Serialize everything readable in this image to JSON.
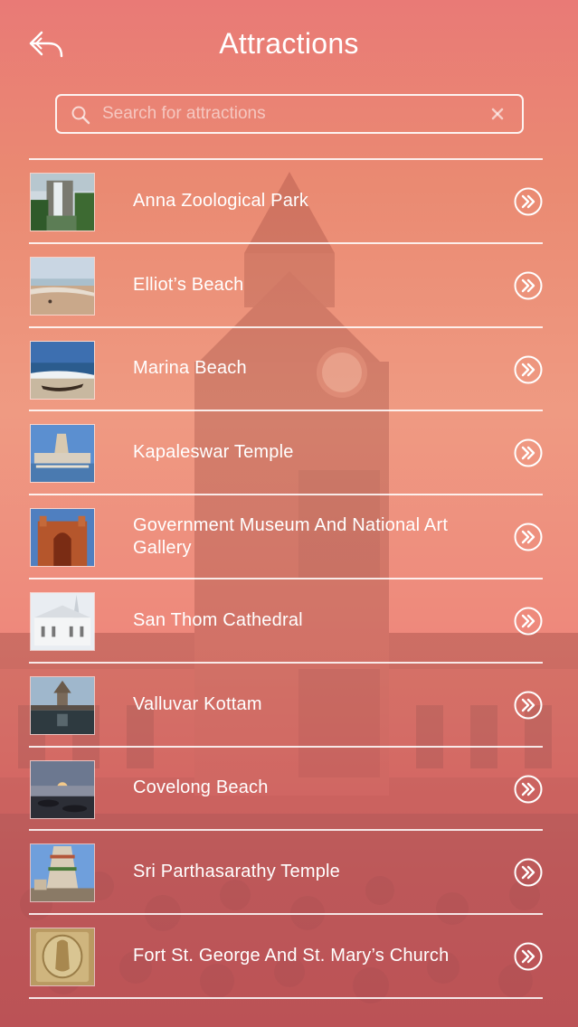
{
  "header": {
    "title": "Attractions",
    "back_icon": "back-arrow-icon"
  },
  "search": {
    "placeholder": "Search for attractions",
    "value": "",
    "icon": "search-icon",
    "clear_icon": "clear-icon"
  },
  "attractions": [
    {
      "name": "Anna Zoological Park",
      "thumb": "waterfall"
    },
    {
      "name": "Elliot’s Beach",
      "thumb": "beach"
    },
    {
      "name": "Marina Beach",
      "thumb": "boat"
    },
    {
      "name": "Kapaleswar Temple",
      "thumb": "temple-tank"
    },
    {
      "name": "Government Museum And National Art Gallery",
      "thumb": "museum"
    },
    {
      "name": "San Thom Cathedral",
      "thumb": "cathedral"
    },
    {
      "name": "Valluvar Kottam",
      "thumb": "chariot"
    },
    {
      "name": "Covelong Beach",
      "thumb": "sunset"
    },
    {
      "name": "Sri Parthasarathy Temple",
      "thumb": "gopuram"
    },
    {
      "name": "Fort St. George And St. Mary’s Church",
      "thumb": "relief"
    }
  ],
  "row_action_icon": "double-chevron-right-icon"
}
